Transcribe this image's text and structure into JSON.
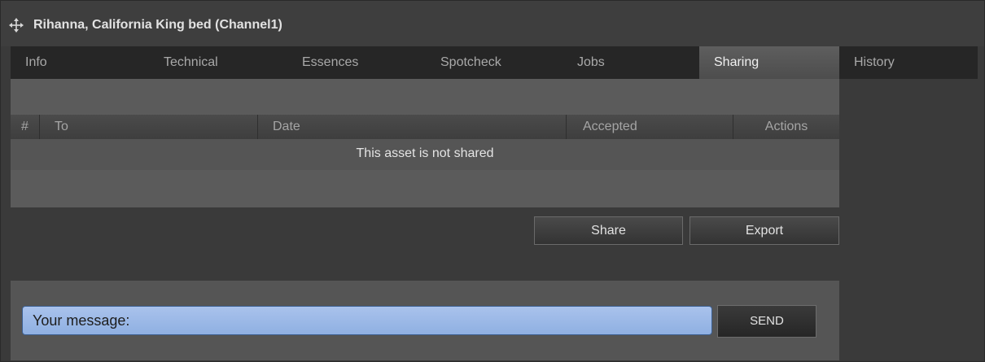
{
  "window": {
    "title": "Rihanna, California King bed (Channel1)"
  },
  "tabs": [
    {
      "label": "Info",
      "active": false
    },
    {
      "label": "Technical",
      "active": false
    },
    {
      "label": "Essences",
      "active": false
    },
    {
      "label": "Spotcheck",
      "active": false
    },
    {
      "label": "Jobs",
      "active": false
    },
    {
      "label": "Sharing",
      "active": true
    },
    {
      "label": "History",
      "active": false
    }
  ],
  "sharing_table": {
    "columns": [
      "#",
      "To",
      "Date",
      "Accepted",
      "Actions"
    ],
    "empty_message": "This asset is not shared"
  },
  "actions": {
    "share_label": "Share",
    "export_label": "Export"
  },
  "message": {
    "placeholder": "Your message:",
    "send_label": "SEND"
  },
  "colors": {
    "accent_input": "#9ab8e8",
    "active_tab": "#585858",
    "background": "#3a3a3a"
  }
}
